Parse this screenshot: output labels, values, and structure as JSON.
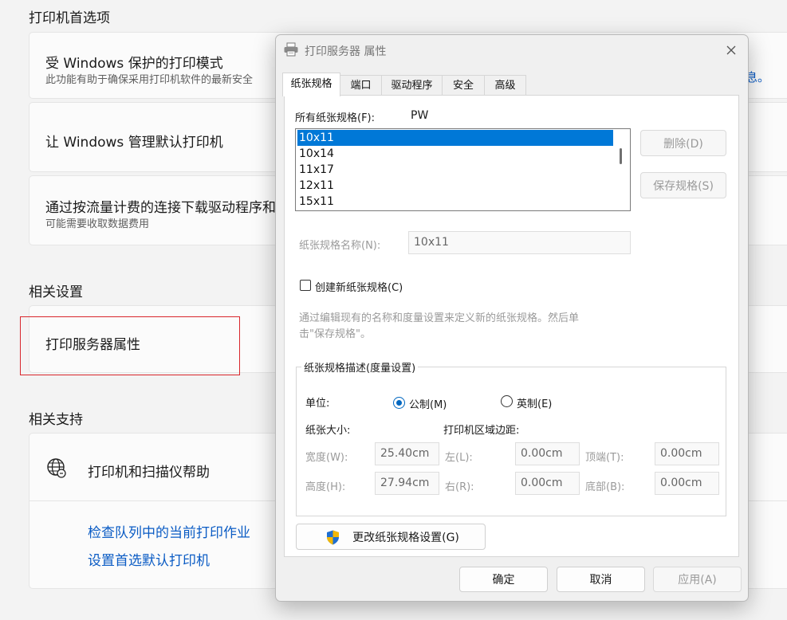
{
  "settings": {
    "section_preferences": "打印机首选项",
    "protected_mode_title": "受 Windows 保护的打印模式",
    "protected_mode_desc": "此功能有助于确保采用打印机软件的最新安全",
    "info_link_tail": "息。",
    "manage_default_title": "让 Windows 管理默认打印机",
    "metered_title": "通过按流量计费的连接下载驱动程序和",
    "metered_desc": "可能需要收取数据费用",
    "section_related_settings": "相关设置",
    "print_server_properties": "打印服务器属性",
    "section_related_support": "相关支持",
    "help_title": "打印机和扫描仪帮助",
    "link_check_queue": "检查队列中的当前打印作业",
    "link_set_default": "设置首选默认打印机"
  },
  "dialog": {
    "title": "打印服务器 属性",
    "tabs": [
      {
        "label": "纸张规格",
        "active": true
      },
      {
        "label": "端口",
        "active": false
      },
      {
        "label": "驱动程序",
        "active": false
      },
      {
        "label": "安全",
        "active": false
      },
      {
        "label": "高级",
        "active": false
      }
    ],
    "forms_label": "所有纸张规格(F):",
    "forms_label_value": "PW",
    "forms": [
      "10x11",
      "10x14",
      "11x17",
      "12x11",
      "15x11"
    ],
    "selected_form": "10x11",
    "delete_button": "删除(D)",
    "save_button": "保存规格(S)",
    "form_name_label": "纸张规格名称(N):",
    "form_name_value": "10x11",
    "create_new_label": "创建新纸张规格(C)",
    "create_new_checked": false,
    "hint_line1": "通过编辑现有的名称和度量设置来定义新的纸张规格。然后单",
    "hint_line2": "击\"保存规格\"。",
    "group_title": "纸张规格描述(度量设置)",
    "units_label": "单位:",
    "metric_label": "公制(M)",
    "english_label": "英制(E)",
    "selected_unit": "metric",
    "paper_size_label": "纸张大小:",
    "margins_label": "打印机区域边距:",
    "width_label": "宽度(W):",
    "width_value": "25.40cm",
    "height_label": "高度(H):",
    "height_value": "27.94cm",
    "left_label": "左(L):",
    "left_value": "0.00cm",
    "right_label": "右(R):",
    "right_value": "0.00cm",
    "top_label": "顶端(T):",
    "top_value": "0.00cm",
    "bottom_label": "底部(B):",
    "bottom_value": "0.00cm",
    "change_settings_button": "更改纸张规格设置(G)",
    "ok_button": "确定",
    "cancel_button": "取消",
    "apply_button": "应用(A)"
  },
  "colors": {
    "accent": "#0078d7",
    "link": "#0a5bc4",
    "highlight_box": "#d9262c"
  },
  "icons": [
    "printer-icon",
    "close-icon",
    "globe-icon",
    "shield-icon"
  ]
}
